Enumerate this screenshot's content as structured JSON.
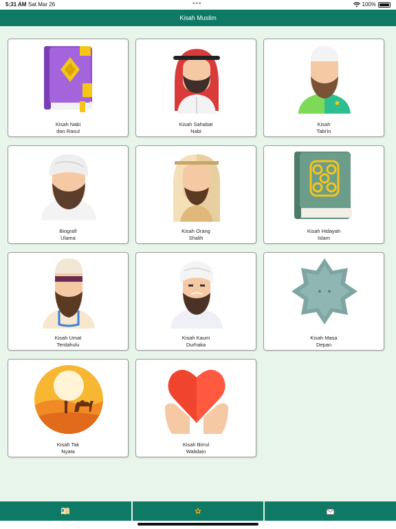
{
  "status_bar": {
    "time": "5:31 AM",
    "date": "Sat Mar 26",
    "battery": "100%",
    "battery_level": 1.0
  },
  "header": {
    "title": "Kisah Muslim"
  },
  "cards": [
    {
      "line1": "Kisah Nabi",
      "line2": "dan Rasul",
      "icon": "quran-book-icon"
    },
    {
      "line1": "Kisah Sahabat",
      "line2": "Nabi",
      "icon": "arab-man-keffiyeh-icon"
    },
    {
      "line1": "Kisah",
      "line2": "Tabi'in",
      "icon": "muslim-man-kufi-icon"
    },
    {
      "line1": "Biografi",
      "line2": "Ulama",
      "icon": "scholar-turban-icon"
    },
    {
      "line1": "Kisah Orang",
      "line2": "Shalih",
      "icon": "pious-man-icon"
    },
    {
      "line1": "Kisah Hidayah",
      "line2": "Islam",
      "icon": "ornate-book-icon"
    },
    {
      "line1": "Kisah Umat",
      "line2": "Terdahulu",
      "icon": "ancient-man-icon"
    },
    {
      "line1": "Kisah Kaum",
      "line2": "Durhaka",
      "icon": "turban-man-icon"
    },
    {
      "line1": "Kisah Masa",
      "line2": "Depan",
      "icon": "octagram-star-icon"
    },
    {
      "line1": "Kisah Tak",
      "line2": "Nyata",
      "icon": "desert-camel-icon"
    },
    {
      "line1": "Kisah Birrul",
      "line2": "Walidain",
      "icon": "heart-hands-icon"
    }
  ],
  "tabs": [
    {
      "icon": "open-book-icon"
    },
    {
      "icon": "home-star-icon"
    },
    {
      "icon": "mail-icon"
    }
  ]
}
